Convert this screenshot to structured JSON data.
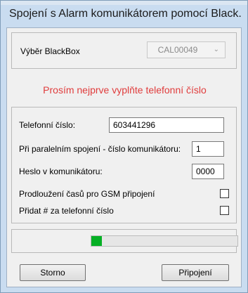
{
  "window": {
    "title": "Spojení s Alarm komunikátorem pomocí Black..."
  },
  "blackbox": {
    "label": "Výběr BlackBox",
    "selected": "CAL00049"
  },
  "message": {
    "text": "Prosím nejprve vyplňte telefonní číslo",
    "color": "#e03c3c"
  },
  "form": {
    "phone_label": "Telefonní číslo:",
    "phone_value": "603441296",
    "comm_number_label": "Při paralelním spojení - číslo komunikátoru:",
    "comm_number_value": "1",
    "password_label": "Heslo v komunikátoru:",
    "password_value": "0000",
    "gsm_label": "Prodloužení časů pro GSM připojení",
    "gsm_checked": false,
    "hash_label": "Přidat # za telefonní číslo",
    "hash_checked": false
  },
  "progress": {
    "percent": 7,
    "color": "#06b025"
  },
  "buttons": {
    "cancel": "Storno",
    "connect": "Připojení"
  },
  "icons": {
    "dropdown": "chevron-down-icon"
  }
}
